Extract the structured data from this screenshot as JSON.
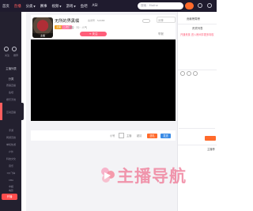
{
  "topbar": {
    "nav": [
      {
        "label": "首页",
        "active": false
      },
      {
        "label": "直播",
        "active": true
      },
      {
        "label": "分类",
        "active": false,
        "caret": true
      },
      {
        "label": "赛事",
        "active": false
      },
      {
        "label": "视频",
        "active": false,
        "caret": true
      },
      {
        "label": "游戏",
        "active": false,
        "caret": true
      },
      {
        "label": "鱼吧",
        "active": false
      },
      {
        "label": "ASI",
        "active": false
      }
    ],
    "search_placeholder": "搜索 · Mathe"
  },
  "sidebar": {
    "items": [
      {
        "label": "关注"
      },
      {
        "label": "推荐"
      },
      {
        "label": "主播列表"
      },
      {
        "label": "分类"
      },
      {
        "label": "赛事直播"
      },
      {
        "label": "鱼吧"
      },
      {
        "label": "娱乐天地"
      },
      {
        "label": "互动直播"
      },
      {
        "label": "手游"
      },
      {
        "label": "网游竞技"
      },
      {
        "label": "单机热游"
      },
      {
        "label": "户外"
      },
      {
        "label": "科技文化"
      },
      {
        "label": "音乐"
      },
      {
        "label": "QQ飞车"
      },
      {
        "label": "CBA"
      },
      {
        "label": "中超"
      },
      {
        "label": "电影"
      }
    ],
    "cta": "开播"
  },
  "room": {
    "avatar_caption": "主播",
    "title": "无所的界黑橘",
    "meta": "房间号 · 52988",
    "tags": [
      "主播",
      "二次元"
    ],
    "sub_info": "熊猫 · 32 · 人气",
    "follow_label": "+ 关注",
    "share_label": "分享",
    "report_label": "举报"
  },
  "player_controls": {
    "left_labels": [
      "小号",
      "主播",
      "超清"
    ],
    "orange_label": "送礼",
    "blue_label": "发送"
  },
  "right_panel": {
    "title": "贡献榜周榜",
    "subtitle": "贵宾列表",
    "link": "开通贵族 进入房间享更多特权",
    "footer": "主播榜"
  },
  "watermark": "主播导航",
  "colors": {
    "accent": "#ff5e5e",
    "topbar": "#1f1b2e",
    "sidebar": "#23202f",
    "follow": "#ff5e7a",
    "send": "#ff6a2b",
    "blue": "#3a8be6"
  }
}
